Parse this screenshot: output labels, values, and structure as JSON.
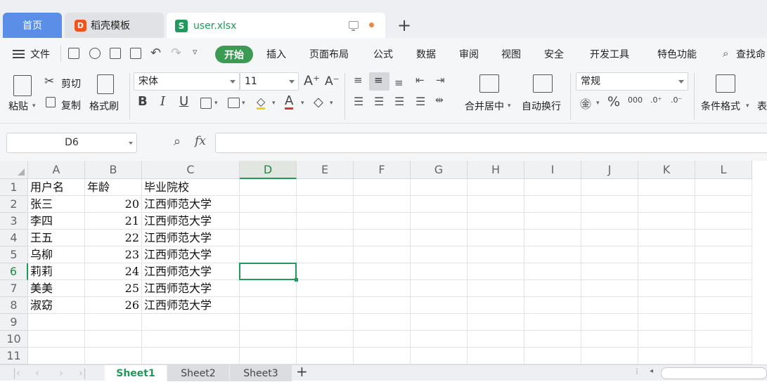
{
  "tabs": {
    "home": "首页",
    "daoke": "稻壳模板",
    "file": "user.xlsx",
    "file_icon_letter": "S",
    "daoke_icon_letter": "D"
  },
  "menu": {
    "file": "文件",
    "start": "开始",
    "items": [
      "插入",
      "页面布局",
      "公式",
      "数据",
      "审阅",
      "视图",
      "安全",
      "开发工具",
      "特色功能"
    ],
    "search": "查找命"
  },
  "ribbon": {
    "paste": "粘贴",
    "cut": "剪切",
    "copy": "复制",
    "format_painter": "格式刷",
    "font_name": "宋体",
    "font_size": "11",
    "merge_center": "合并居中",
    "wrap_text": "自动换行",
    "number_format": "常规",
    "cond_format": "条件格式",
    "table_partial": "表"
  },
  "formula_bar": {
    "name_box": "D6",
    "fx": "fx",
    "value": ""
  },
  "grid": {
    "columns": [
      "A",
      "B",
      "C",
      "D",
      "E",
      "F",
      "G",
      "H",
      "I",
      "J",
      "K",
      "L"
    ],
    "active_column": "D",
    "active_row": 6,
    "row_numbers": [
      "1",
      "2",
      "3",
      "4",
      "5",
      "6",
      "7",
      "8",
      "9",
      "10",
      "11"
    ],
    "rows": [
      [
        "用户名",
        "年龄",
        "毕业院校"
      ],
      [
        "张三",
        "20",
        "江西师范大学"
      ],
      [
        "李四",
        "21",
        "江西师范大学"
      ],
      [
        "王五",
        "22",
        "江西师范大学"
      ],
      [
        "乌柳",
        "23",
        "江西师范大学"
      ],
      [
        "莉莉",
        "24",
        "江西师范大学"
      ],
      [
        "美美",
        "25",
        "江西师范大学"
      ],
      [
        "淑窈",
        "26",
        "江西师范大学"
      ]
    ]
  },
  "sheets": {
    "tabs": [
      "Sheet1",
      "Sheet2",
      "Sheet3"
    ],
    "active": "Sheet1"
  },
  "colors": {
    "accent_green": "#1f9a5b",
    "home_tab_blue": "#5b8ee6",
    "dirty_dot": "#f0883e"
  }
}
